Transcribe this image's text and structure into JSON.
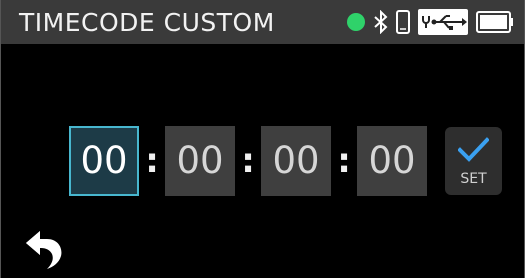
{
  "header": {
    "title": "TIMECODE CUSTOM",
    "icons": [
      "status-dot-icon",
      "bluetooth-icon",
      "phone-icon",
      "usb-power-icon",
      "battery-icon"
    ],
    "status_dot_color": "#2fd26a"
  },
  "timecode": {
    "fields": [
      "00",
      "00",
      "00",
      "00"
    ],
    "separator": ":",
    "active_index": 0
  },
  "set_button": {
    "label": "SET",
    "icon": "checkmark-icon",
    "accent_color": "#3aa0f0"
  },
  "back_button": {
    "icon": "back-arrow-icon"
  }
}
